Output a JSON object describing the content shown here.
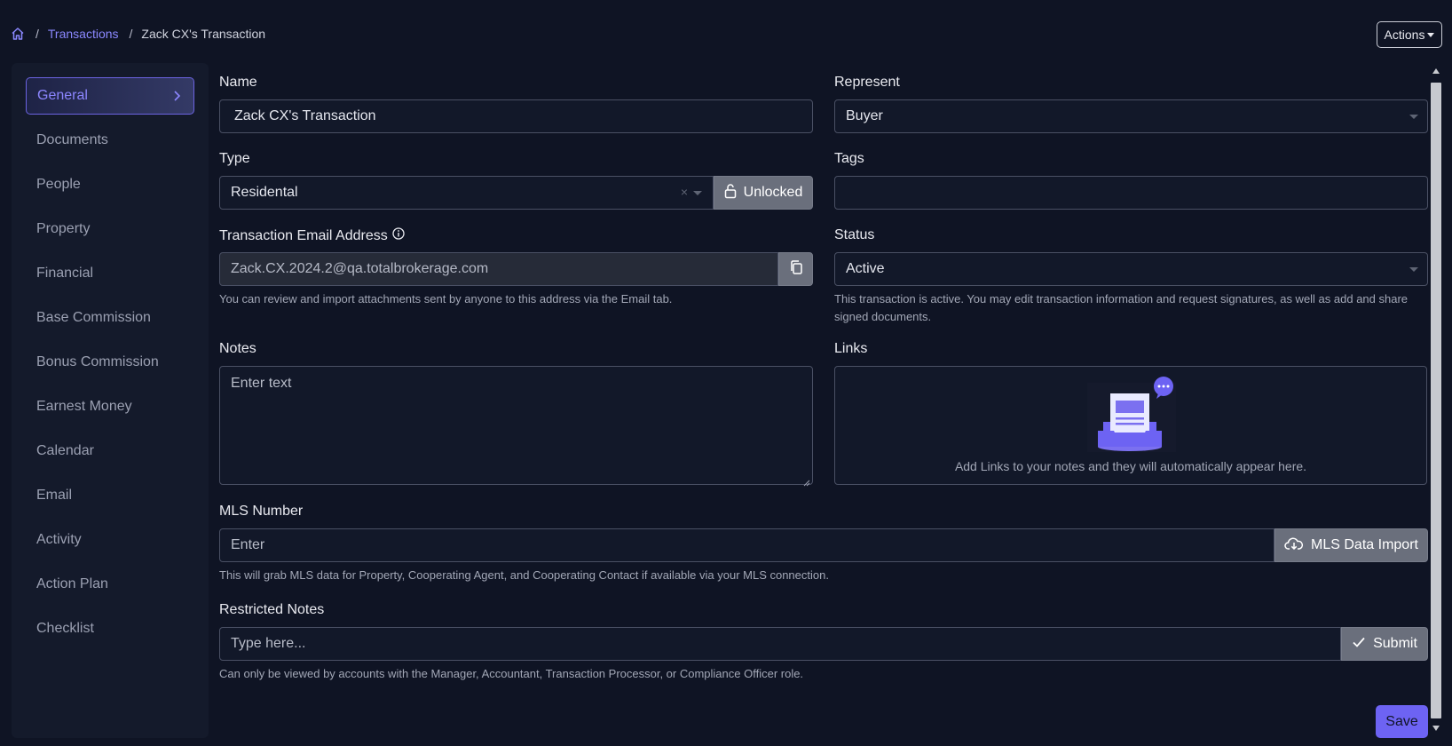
{
  "breadcrumb": {
    "home_icon": "home-icon",
    "link": "Transactions",
    "current": "Zack CX's Transaction"
  },
  "actions_label": "Actions",
  "sidebar": {
    "items": [
      {
        "label": "General",
        "active": true
      },
      {
        "label": "Documents"
      },
      {
        "label": "People"
      },
      {
        "label": "Property"
      },
      {
        "label": "Financial"
      },
      {
        "label": "Base Commission"
      },
      {
        "label": "Bonus Commission"
      },
      {
        "label": "Earnest Money"
      },
      {
        "label": "Calendar"
      },
      {
        "label": "Email"
      },
      {
        "label": "Activity"
      },
      {
        "label": "Action Plan"
      },
      {
        "label": "Checklist"
      }
    ]
  },
  "form": {
    "name": {
      "label": "Name",
      "value": "Zack CX's Transaction"
    },
    "represent": {
      "label": "Represent",
      "value": "Buyer"
    },
    "type": {
      "label": "Type",
      "value": "Residental",
      "lock_label": "Unlocked"
    },
    "tags": {
      "label": "Tags",
      "value": ""
    },
    "email": {
      "label": "Transaction Email Address",
      "value": "Zack.CX.2024.2@qa.totalbrokerage.com",
      "help": "You can review and import attachments sent by anyone to this address via the Email tab."
    },
    "status": {
      "label": "Status",
      "value": "Active",
      "help": "This transaction is active. You may edit transaction information and request signatures, as well as add and share signed documents."
    },
    "notes": {
      "label": "Notes",
      "placeholder": "Enter text"
    },
    "links": {
      "label": "Links",
      "empty_text": "Add Links to your notes and they will automatically appear here."
    },
    "mls": {
      "label": "MLS Number",
      "placeholder": "Enter",
      "button": "MLS Data Import",
      "help": "This will grab MLS data for Property, Cooperating Agent, and Cooperating Contact if available via your MLS connection."
    },
    "restricted": {
      "label": "Restricted Notes",
      "placeholder": "Type here...",
      "button": "Submit",
      "help": "Can only be viewed by accounts with the Manager, Accountant, Transaction Processor, or Compliance Officer role."
    }
  },
  "save_label": "Save",
  "colors": {
    "accent": "#6d63f3",
    "background": "#0f1424",
    "sidebar": "#141a2b"
  }
}
